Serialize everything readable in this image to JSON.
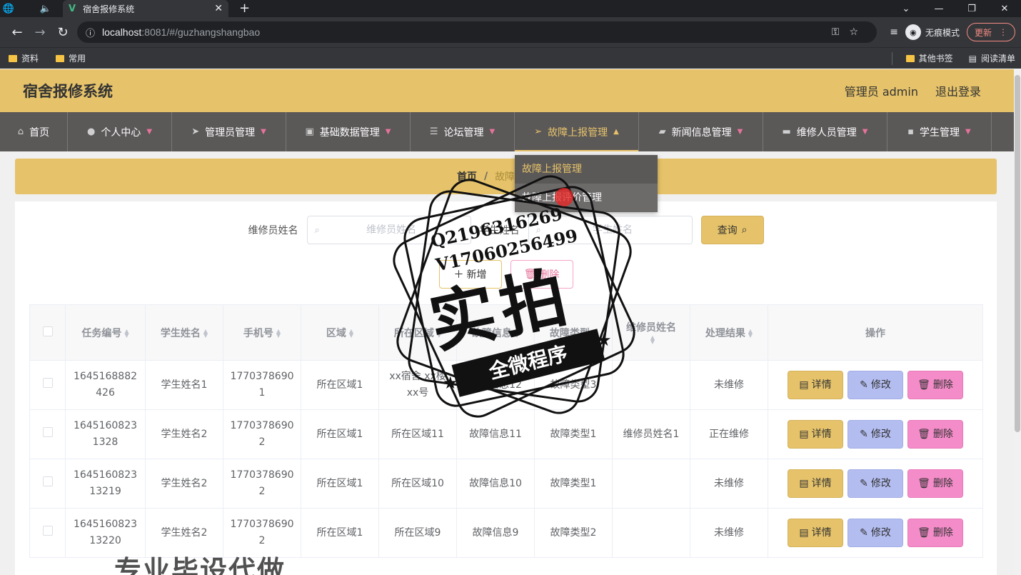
{
  "browser": {
    "tab_title": "宿舍报修系统",
    "url_host": "localhost",
    "url_path": ":8081/#/guzhangshangbao",
    "incognito_label": "无痕模式",
    "update_label": "更新",
    "bookmarks": [
      "资料",
      "常用"
    ],
    "bookmarks_right": [
      "其他书签",
      "阅读清单"
    ]
  },
  "header": {
    "title": "宿舍报修系统",
    "user": "管理员 admin",
    "logout": "退出登录"
  },
  "nav": {
    "items": [
      {
        "label": "首页",
        "icon": "home-icon"
      },
      {
        "label": "个人中心",
        "icon": "user-icon"
      },
      {
        "label": "管理员管理",
        "icon": "send-icon"
      },
      {
        "label": "基础数据管理",
        "icon": "stamp-icon"
      },
      {
        "label": "论坛管理",
        "icon": "sliders-icon"
      },
      {
        "label": "故障上报管理",
        "icon": "navigation-icon"
      },
      {
        "label": "新闻信息管理",
        "icon": "news-icon"
      },
      {
        "label": "维修人员管理",
        "icon": "printer-icon"
      },
      {
        "label": "学生管理",
        "icon": "chat-icon"
      }
    ],
    "dropdown": [
      "故障上报管理",
      "故障上报评价管理"
    ]
  },
  "breadcrumb": {
    "home": "首页",
    "sep": "/",
    "current": "故障上报管理"
  },
  "search": {
    "label1": "维修员姓名",
    "placeholder1": "维修员姓名",
    "label2": "学生姓名",
    "placeholder2": "学生姓名",
    "query": "查询"
  },
  "actions": {
    "add": "新增",
    "delete": "删除"
  },
  "table": {
    "columns": [
      "任务编号",
      "学生姓名",
      "手机号",
      "区域",
      "所在区域",
      "故障信息",
      "故障类型",
      "维修员姓名",
      "处理结果",
      "操作"
    ],
    "rows": [
      [
        "1645168882426",
        "学生姓名1",
        "17703786901",
        "所在区域1",
        "xx宿舍 xx楼 xx号",
        "故障信息12",
        "故障类型3",
        "",
        "未维修"
      ],
      [
        "16451608231328",
        "学生姓名2",
        "17703786902",
        "所在区域1",
        "所在区域11",
        "故障信息11",
        "故障类型1",
        "维修员姓名1",
        "正在维修"
      ],
      [
        "164516082313219",
        "学生姓名2",
        "17703786902",
        "所在区域1",
        "所在区域10",
        "故障信息10",
        "故障类型1",
        "",
        "未维修"
      ],
      [
        "164516082313220",
        "学生姓名2",
        "17703786902",
        "所在区域1",
        "所在区域9",
        "故障信息9",
        "故障类型2",
        "",
        "未维修"
      ]
    ],
    "ops": {
      "detail": "详情",
      "edit": "修改",
      "remove": "删除"
    }
  },
  "watermark": {
    "contact1": "Q2196316269",
    "contact2": "V17060256499",
    "big": "实拍",
    "ribbon": "全微程序",
    "footer": "专业毕设代做"
  }
}
